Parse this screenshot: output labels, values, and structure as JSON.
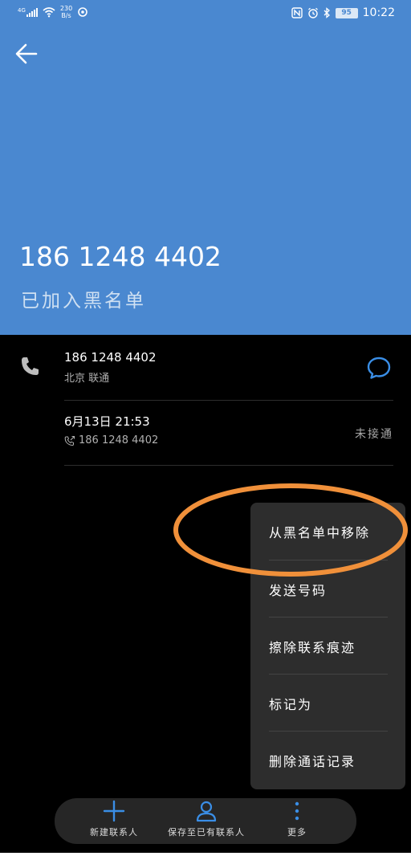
{
  "status_bar": {
    "network": "4G",
    "speed_value": "230",
    "speed_unit": "B/s",
    "battery": "95",
    "time": "10:22"
  },
  "header": {
    "phone_number": "186 1248 4402",
    "status": "已加入黑名单"
  },
  "contact_row": {
    "number": "186 1248 4402",
    "location": "北京 联通"
  },
  "call_log": {
    "datetime": "6月13日 21:53",
    "number": "186 1248 4402",
    "status": "未接通"
  },
  "menu": {
    "items": [
      {
        "label": "从黑名单中移除"
      },
      {
        "label": "发送号码"
      },
      {
        "label": "擦除联系痕迹"
      },
      {
        "label": "标记为"
      },
      {
        "label": "删除通话记录"
      }
    ]
  },
  "bottom_bar": {
    "new_contact": "新建联系人",
    "save_existing": "保存至已有联系人",
    "more": "更多"
  },
  "colors": {
    "header_bg": "#4a88d0",
    "accent_blue": "#3a8ee6",
    "annotation": "#f0903a",
    "menu_bg": "#2d2d2d"
  }
}
